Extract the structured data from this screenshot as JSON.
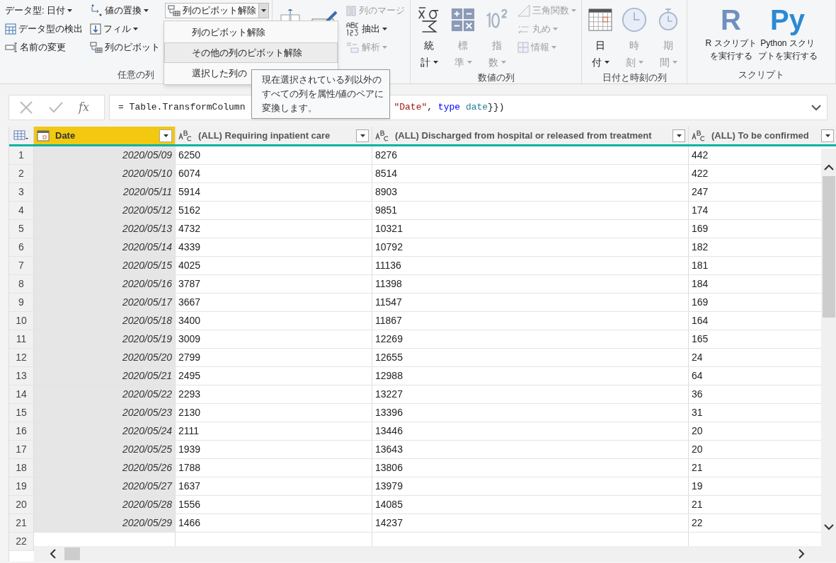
{
  "ribbon": {
    "groups": [
      {
        "label": "任意の列",
        "items": [
          {
            "kind": "small",
            "label": "データ型: 日付",
            "dropdown": true,
            "disabled": false
          },
          {
            "kind": "small",
            "label": "データ型の検出",
            "dropdown": false,
            "disabled": false
          },
          {
            "kind": "small",
            "label": "名前の変更",
            "dropdown": false,
            "disabled": false
          },
          {
            "kind": "small",
            "label": "値の置換",
            "dropdown": true,
            "disabled": false
          },
          {
            "kind": "small",
            "label": "フィル",
            "dropdown": true,
            "disabled": false
          },
          {
            "kind": "small",
            "label": "列のピボット",
            "dropdown": false,
            "disabled": false
          },
          {
            "kind": "split",
            "label": "列のピボット解除",
            "dropdown": true,
            "disabled": false,
            "expanded": true
          }
        ]
      },
      {
        "items": [
          {
            "kind": "big"
          },
          {
            "kind": "big"
          },
          {
            "kind": "small",
            "label": "列のマージ",
            "dropdown": false,
            "disabled": true
          },
          {
            "kind": "small",
            "label": "抽出",
            "dropdown": true,
            "disabled": false
          },
          {
            "kind": "small",
            "label": "解析",
            "dropdown": true,
            "disabled": true
          }
        ]
      },
      {
        "label": "数値の列",
        "items": [
          {
            "kind": "big",
            "label": [
              "統",
              "計"
            ],
            "dropdown": true,
            "disabled": false
          },
          {
            "kind": "big",
            "label": [
              "標",
              "準"
            ],
            "dropdown": true,
            "disabled": true
          },
          {
            "kind": "big",
            "label": [
              "指",
              "数"
            ],
            "dropdown": true,
            "disabled": true
          },
          {
            "kind": "small",
            "label": "三角関数",
            "dropdown": true,
            "disabled": true
          },
          {
            "kind": "small",
            "label": "丸め",
            "dropdown": true,
            "disabled": true
          },
          {
            "kind": "small",
            "label": "情報",
            "dropdown": true,
            "disabled": true
          }
        ]
      },
      {
        "label": "日付と時刻の列",
        "items": [
          {
            "kind": "big",
            "label": [
              "日",
              "付"
            ],
            "dropdown": true,
            "disabled": false
          },
          {
            "kind": "big",
            "label": [
              "時",
              "刻"
            ],
            "dropdown": true,
            "disabled": true
          },
          {
            "kind": "big",
            "label": [
              "期",
              "間"
            ],
            "dropdown": true,
            "disabled": true
          }
        ]
      },
      {
        "label": "スクリプト",
        "items": [
          {
            "kind": "script",
            "logo": "R",
            "label": [
              "R スクリプト",
              "を実行する"
            ],
            "color": "#6f8fbf"
          },
          {
            "kind": "script",
            "logo": "Py",
            "label": [
              "Python スクリ",
              "プトを実行する"
            ],
            "color": "#2a8ad4"
          }
        ]
      }
    ]
  },
  "dropdown_menu": [
    {
      "label": "列のピボット解除",
      "selected": false
    },
    {
      "label": "その他の列のピボット解除",
      "selected": true
    },
    {
      "label": "選択した列の",
      "selected": false
    }
  ],
  "tooltip": "現在選択されている列以外のすべての列を属性/値のペアに変換します。",
  "formula_bar": {
    "fx_label": "fx",
    "parts": [
      {
        "kind": "plain",
        "text": "= Table.TransformColumn"
      },
      {
        "kind": "string",
        "text": "\"Date\""
      },
      {
        "kind": "plain",
        "text": ", "
      },
      {
        "kind": "keyword",
        "text": "type"
      },
      {
        "kind": "ident",
        "text": " date"
      },
      {
        "kind": "plain",
        "text": "}})"
      }
    ]
  },
  "table": {
    "columns": [
      {
        "name": "Date",
        "kind": "date",
        "selected": true
      },
      {
        "name": "(ALL) Requiring inpatient care",
        "kind": "text",
        "selected": false
      },
      {
        "name": "(ALL) Discharged from hospital or released from treatment",
        "kind": "text",
        "selected": false
      },
      {
        "name": "(ALL) To be confirmed",
        "kind": "text",
        "selected": false
      }
    ],
    "rows": [
      {
        "n": "1",
        "cells": [
          "2020/05/09",
          "6250",
          "8276",
          "442"
        ]
      },
      {
        "n": "2",
        "cells": [
          "2020/05/10",
          "6074",
          "8514",
          "422"
        ]
      },
      {
        "n": "3",
        "cells": [
          "2020/05/11",
          "5914",
          "8903",
          "247"
        ]
      },
      {
        "n": "4",
        "cells": [
          "2020/05/12",
          "5162",
          "9851",
          "174"
        ]
      },
      {
        "n": "5",
        "cells": [
          "2020/05/13",
          "4732",
          "10321",
          "169"
        ]
      },
      {
        "n": "6",
        "cells": [
          "2020/05/14",
          "4339",
          "10792",
          "182"
        ]
      },
      {
        "n": "7",
        "cells": [
          "2020/05/15",
          "4025",
          "11136",
          "181"
        ]
      },
      {
        "n": "8",
        "cells": [
          "2020/05/16",
          "3787",
          "11398",
          "184"
        ]
      },
      {
        "n": "9",
        "cells": [
          "2020/05/17",
          "3667",
          "11547",
          "169"
        ]
      },
      {
        "n": "10",
        "cells": [
          "2020/05/18",
          "3400",
          "11867",
          "164"
        ]
      },
      {
        "n": "11",
        "cells": [
          "2020/05/19",
          "3009",
          "12269",
          "165"
        ]
      },
      {
        "n": "12",
        "cells": [
          "2020/05/20",
          "2799",
          "12655",
          "24"
        ]
      },
      {
        "n": "13",
        "cells": [
          "2020/05/21",
          "2495",
          "12988",
          "64"
        ]
      },
      {
        "n": "14",
        "cells": [
          "2020/05/22",
          "2293",
          "13227",
          "36"
        ]
      },
      {
        "n": "15",
        "cells": [
          "2020/05/23",
          "2130",
          "13396",
          "31"
        ]
      },
      {
        "n": "16",
        "cells": [
          "2020/05/24",
          "2111",
          "13446",
          "20"
        ]
      },
      {
        "n": "17",
        "cells": [
          "2020/05/25",
          "1939",
          "13643",
          "20"
        ]
      },
      {
        "n": "18",
        "cells": [
          "2020/05/26",
          "1788",
          "13806",
          "21"
        ]
      },
      {
        "n": "19",
        "cells": [
          "2020/05/27",
          "1637",
          "13979",
          "19"
        ]
      },
      {
        "n": "20",
        "cells": [
          "2020/05/28",
          "1556",
          "14085",
          "21"
        ]
      },
      {
        "n": "21",
        "cells": [
          "2020/05/29",
          "1466",
          "14237",
          "22"
        ]
      },
      {
        "n": "22",
        "cells": []
      }
    ]
  }
}
